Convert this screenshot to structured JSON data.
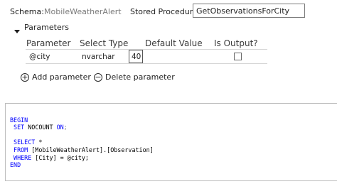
{
  "header": {
    "schema_label": "Schema:",
    "schema_value": "MobileWeatherAlert",
    "proc_label": "Stored Procedure:",
    "proc_value": "GetObservationsForCity"
  },
  "parameters": {
    "section_label": "Parameters",
    "columns": [
      "Parameter",
      "Select Type",
      "Default Value",
      "Is Output?"
    ],
    "rows": [
      {
        "parameter": "@city",
        "type": "nvarchar",
        "length": "40",
        "default": "",
        "is_output": false
      }
    ],
    "add_label": "Add parameter",
    "delete_label": "Delete parameter"
  },
  "sql": {
    "l1": "BEGIN",
    "l2_kw": "SET",
    "l2_mid": " NOCOUNT ",
    "l2_on": "ON",
    "l2_end": ";",
    "l3": "",
    "l4_kw": "SELECT",
    "l4_rest": " *",
    "l5_kw": "FROM",
    "l5_rest": " [MobileWeatherAlert].[Observation]",
    "l6_kw": "WHERE",
    "l6_rest": " [City] = @city;",
    "l7": "END"
  }
}
